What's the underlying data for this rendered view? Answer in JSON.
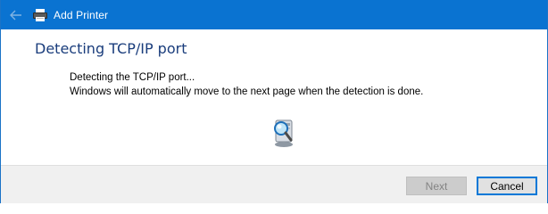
{
  "window": {
    "title": "Add Printer"
  },
  "page": {
    "heading": "Detecting TCP/IP port",
    "line1": "Detecting the TCP/IP port...",
    "line2": "Windows will automatically move to the next page when the detection is done."
  },
  "buttons": {
    "next_label": "Next",
    "cancel_label": "Cancel"
  },
  "icons": {
    "back": "back-arrow-icon",
    "printer": "printer-icon",
    "detecting": "computer-magnifier-icon"
  },
  "colors": {
    "titlebar": "#0a73d1",
    "heading": "#1a3d7c",
    "cancel_border": "#0078d7"
  }
}
